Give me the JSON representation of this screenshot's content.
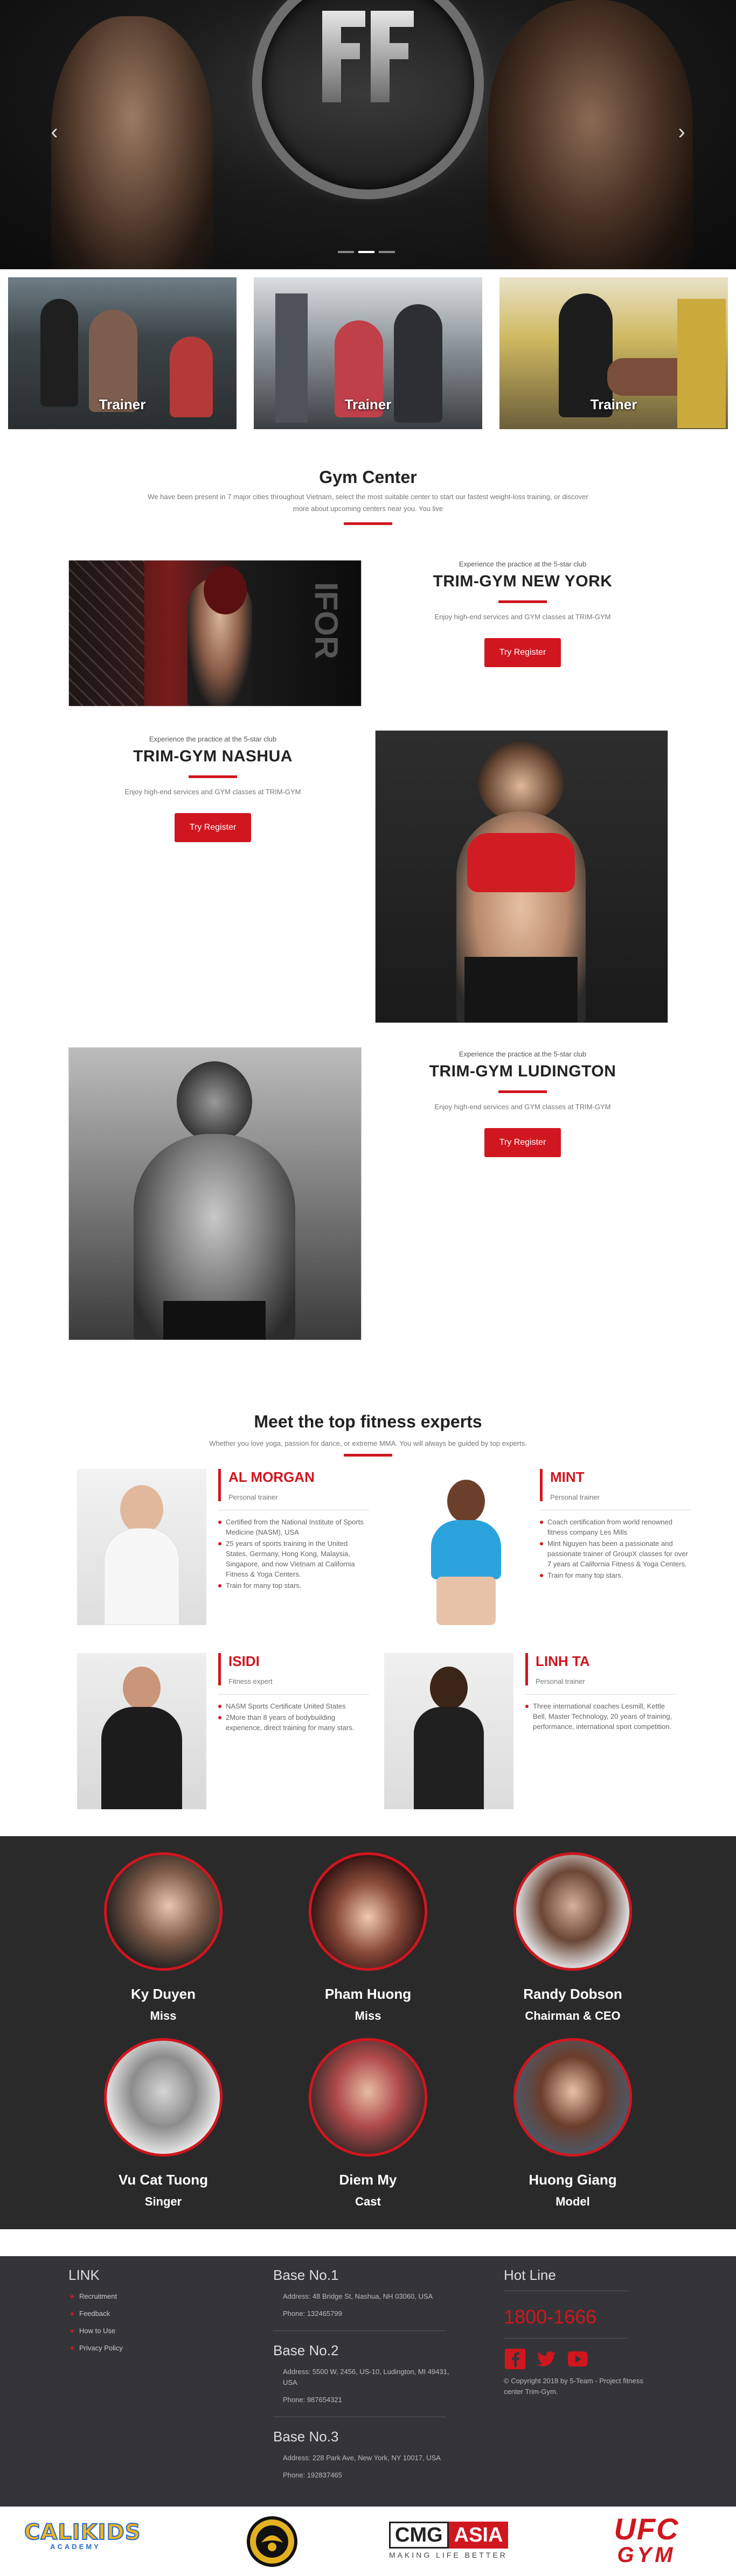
{
  "hero": {
    "prev_glyph": "‹",
    "next_glyph": "›",
    "slides": 3,
    "active_slide": 2
  },
  "trainers": [
    {
      "label": "Trainer"
    },
    {
      "label": "Trainer"
    },
    {
      "label": "Trainer"
    }
  ],
  "gym_center": {
    "title": "Gym Center",
    "description": "We have been present in 7 major cities throughout Vietnam, select the most suitable center to start our fastest weight-loss training, or discover more about upcoming centers near you. You live"
  },
  "clubs": [
    {
      "pre": "Experience the practice at the 5-star club",
      "name": "TRIM-GYM NEW YORK",
      "desc": "Enjoy high-end services and GYM classes at TRIM-GYM",
      "button": "Try Register"
    },
    {
      "pre": "Experience the practice at the 5-star club",
      "name": "TRIM-GYM NASHUA",
      "desc": "Enjoy high-end services and GYM classes at TRIM-GYM",
      "button": "Try Register"
    },
    {
      "pre": "Experience the practice at the 5-star club",
      "name": "TRIM-GYM LUDINGTON",
      "desc": "Enjoy high-end services and GYM classes at TRIM-GYM",
      "button": "Try Register"
    }
  ],
  "club_photo_text": "IFOR",
  "experts_section": {
    "title": "Meet the top fitness experts",
    "subtitle": "Whether you love yoga, passion for dance, or extreme MMA. You will always be guided by top experts."
  },
  "experts": [
    {
      "name": "AL MORGAN",
      "role": "Personal trainer",
      "points": [
        "Certified from the National Institute of Sports Medicine (NASM), USA",
        "25 years of sports training in the United States, Germany, Hong Kong, Malaysia, Singapore, and now Vietnam at California Fitness & Yoga Centers.",
        "Train for many top stars."
      ]
    },
    {
      "name": "MINT",
      "role": "Personal trainer",
      "points": [
        "Coach certification from world renowned fitness company Les Mills",
        "Mint Nguyen has been a passionate and passionate trainer of GroupX classes for over 7 years at California Fitness & Yoga Centers.",
        "Train for many top stars."
      ]
    },
    {
      "name": "ISIDI",
      "role": "Fitness expert",
      "points": [
        "NASM Sports Certificate United States",
        "2More than 8 years of bodybuilding experience, direct training for many stars."
      ]
    },
    {
      "name": "LINH TA",
      "role": "Personal trainer",
      "points": [
        "Three international coaches Lesmill, Kettle Bell, Master Technology, 20 years of training, performance, international sport competition."
      ]
    }
  ],
  "celebs": [
    {
      "name": "Ky Duyen",
      "title": "Miss"
    },
    {
      "name": "Pham Huong",
      "title": "Miss"
    },
    {
      "name": "Randy Dobson",
      "title": "Chairman & CEO"
    },
    {
      "name": "Vu Cat Tuong",
      "title": "Singer"
    },
    {
      "name": "Diem My",
      "title": "Cast"
    },
    {
      "name": "Huong Giang",
      "title": "Model"
    }
  ],
  "footer": {
    "link_heading": "LINK",
    "links": [
      "Recruitment",
      "Feedback",
      "How to Use",
      "Privacy Policy"
    ],
    "bases": [
      {
        "title": "Base No.1",
        "address": "Address: 48 Bridge St, Nashua, NH 03060, USA",
        "phone": "Phone: 132465799"
      },
      {
        "title": "Base No.2",
        "address": "Address: 5500 W, 2456, US-10, Ludington, MI 49431, USA",
        "phone": "Phone: 987654321"
      },
      {
        "title": "Base No.3",
        "address": "Address: 228 Park Ave, New York, NY 10017, USA",
        "phone": "Phone: 192837465"
      }
    ],
    "hotline_heading": "Hot Line",
    "hotline": "1800-1666",
    "copyright": "© Copyright 2018 by 5-Team - Project fitness center Trim-Gym."
  },
  "partners": [
    {
      "name": "CALIKIDS",
      "sub": "ACADEMY"
    },
    {
      "name": "emblem"
    },
    {
      "name": "CMG",
      "accent": "ASIA",
      "sub": "MAKING LIFE BETTER"
    },
    {
      "name": "UFC",
      "sub": "GYM"
    }
  ],
  "colors": {
    "accent": "#d0161f",
    "dark": "#2a2a2a",
    "footer": "#353539"
  }
}
